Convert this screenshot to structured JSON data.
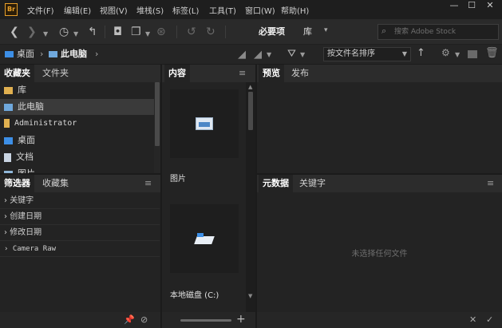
{
  "menubar": {
    "logo": "Br",
    "items": [
      "文件(F)",
      "编辑(E)",
      "视图(V)",
      "堆栈(S)",
      "标签(L)",
      "工具(T)",
      "窗口(W)",
      "帮助(H)"
    ],
    "window_buttons": [
      "—",
      "☐",
      "✕"
    ]
  },
  "toolbar": {
    "workspace_essentials": "必要项",
    "workspace_library": "库",
    "search_placeholder": "搜索 Adobe Stock"
  },
  "breadcrumb": {
    "items": [
      "桌面",
      "此电脑"
    ]
  },
  "sort": {
    "label": "按文件名排序"
  },
  "favorites_panel": {
    "tabs": [
      "收藏夹",
      "文件夹"
    ],
    "items": [
      "库",
      "此电脑",
      "Administrator",
      "桌面",
      "文档",
      "图片"
    ],
    "selected_index": 1
  },
  "filter_panel": {
    "tabs": [
      "筛选器",
      "收藏集"
    ],
    "items": [
      "关键字",
      "创建日期",
      "修改日期",
      "Camera Raw"
    ]
  },
  "content_panel": {
    "tab": "内容",
    "items": [
      "图片",
      "本地磁盘 (C:)"
    ]
  },
  "preview_panel": {
    "tabs": [
      "预览",
      "发布"
    ]
  },
  "metadata_panel": {
    "tabs": [
      "元数据",
      "关键字"
    ],
    "empty_message": "未选择任何文件"
  },
  "colors": {
    "accent": "#3d8fe6",
    "logo": "#e8a02a",
    "folder": "#e0b050"
  }
}
